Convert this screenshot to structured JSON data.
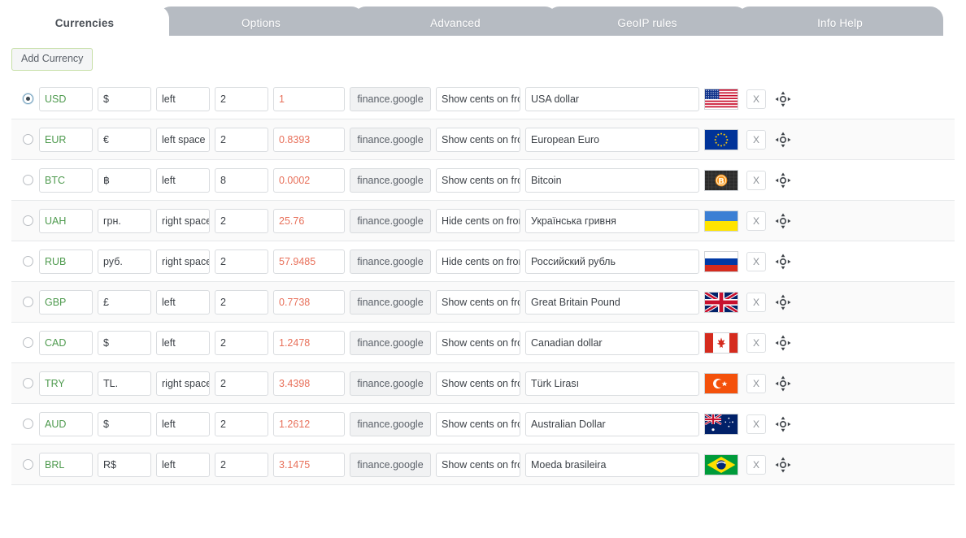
{
  "tabs": [
    {
      "label": "Currencies",
      "active": true
    },
    {
      "label": "Options",
      "active": false
    },
    {
      "label": "Advanced",
      "active": false
    },
    {
      "label": "GeoIP rules",
      "active": false
    },
    {
      "label": "Info Help",
      "active": false
    }
  ],
  "toolbar": {
    "add_currency_label": "Add Currency"
  },
  "row_controls": {
    "delete_label": "X",
    "move_icon": "move-handle-icon",
    "source_label": "finance.google"
  },
  "colors": {
    "tab_inactive_bg": "#b6bbc2",
    "tab_active_bg": "#ffffff",
    "code_text": "#4e9a4e",
    "rate_text": "#e8705a",
    "add_button_border": "#c6dfa6",
    "row_alt_bg": "#fafafa"
  },
  "currencies": [
    {
      "selected": true,
      "code": "USD",
      "symbol": "$",
      "position": "left",
      "decimals": "2",
      "rate": "1",
      "source": "finance.google",
      "cents": "Show cents on front",
      "name": "USA dollar",
      "flag": "flag-us"
    },
    {
      "selected": false,
      "code": "EUR",
      "symbol": "€",
      "position": "left space",
      "decimals": "2",
      "rate": "0.8393",
      "source": "finance.google",
      "cents": "Show cents on front",
      "name": "European Euro",
      "flag": "flag-eu"
    },
    {
      "selected": false,
      "code": "BTC",
      "symbol": "฿",
      "position": "left",
      "decimals": "8",
      "rate": "0.0002",
      "source": "finance.google",
      "cents": "Show cents on front",
      "name": "Bitcoin",
      "flag": "flag-btc"
    },
    {
      "selected": false,
      "code": "UAH",
      "symbol": "грн.",
      "position": "right space",
      "decimals": "2",
      "rate": "25.76",
      "source": "finance.google",
      "cents": "Hide cents on front",
      "name": "Українська гривня",
      "flag": "flag-ua"
    },
    {
      "selected": false,
      "code": "RUB",
      "symbol": "руб.",
      "position": "right space",
      "decimals": "2",
      "rate": "57.9485",
      "source": "finance.google",
      "cents": "Hide cents on front",
      "name": "Российский рубль",
      "flag": "flag-ru"
    },
    {
      "selected": false,
      "code": "GBP",
      "symbol": "£",
      "position": "left",
      "decimals": "2",
      "rate": "0.7738",
      "source": "finance.google",
      "cents": "Show cents on front",
      "name": "Great Britain Pound",
      "flag": "flag-gb"
    },
    {
      "selected": false,
      "code": "CAD",
      "symbol": "$",
      "position": "left",
      "decimals": "2",
      "rate": "1.2478",
      "source": "finance.google",
      "cents": "Show cents on front",
      "name": "Canadian dollar",
      "flag": "flag-ca"
    },
    {
      "selected": false,
      "code": "TRY",
      "symbol": "TL.",
      "position": "right space",
      "decimals": "2",
      "rate": "3.4398",
      "source": "finance.google",
      "cents": "Show cents on front",
      "name": "Türk Lirası",
      "flag": "flag-tr"
    },
    {
      "selected": false,
      "code": "AUD",
      "symbol": "$",
      "position": "left",
      "decimals": "2",
      "rate": "1.2612",
      "source": "finance.google",
      "cents": "Show cents on front",
      "name": "Australian Dollar",
      "flag": "flag-au"
    },
    {
      "selected": false,
      "code": "BRL",
      "symbol": "R$",
      "position": "left",
      "decimals": "2",
      "rate": "3.1475",
      "source": "finance.google",
      "cents": "Show cents on front",
      "name": "Moeda brasileira",
      "flag": "flag-br"
    }
  ]
}
